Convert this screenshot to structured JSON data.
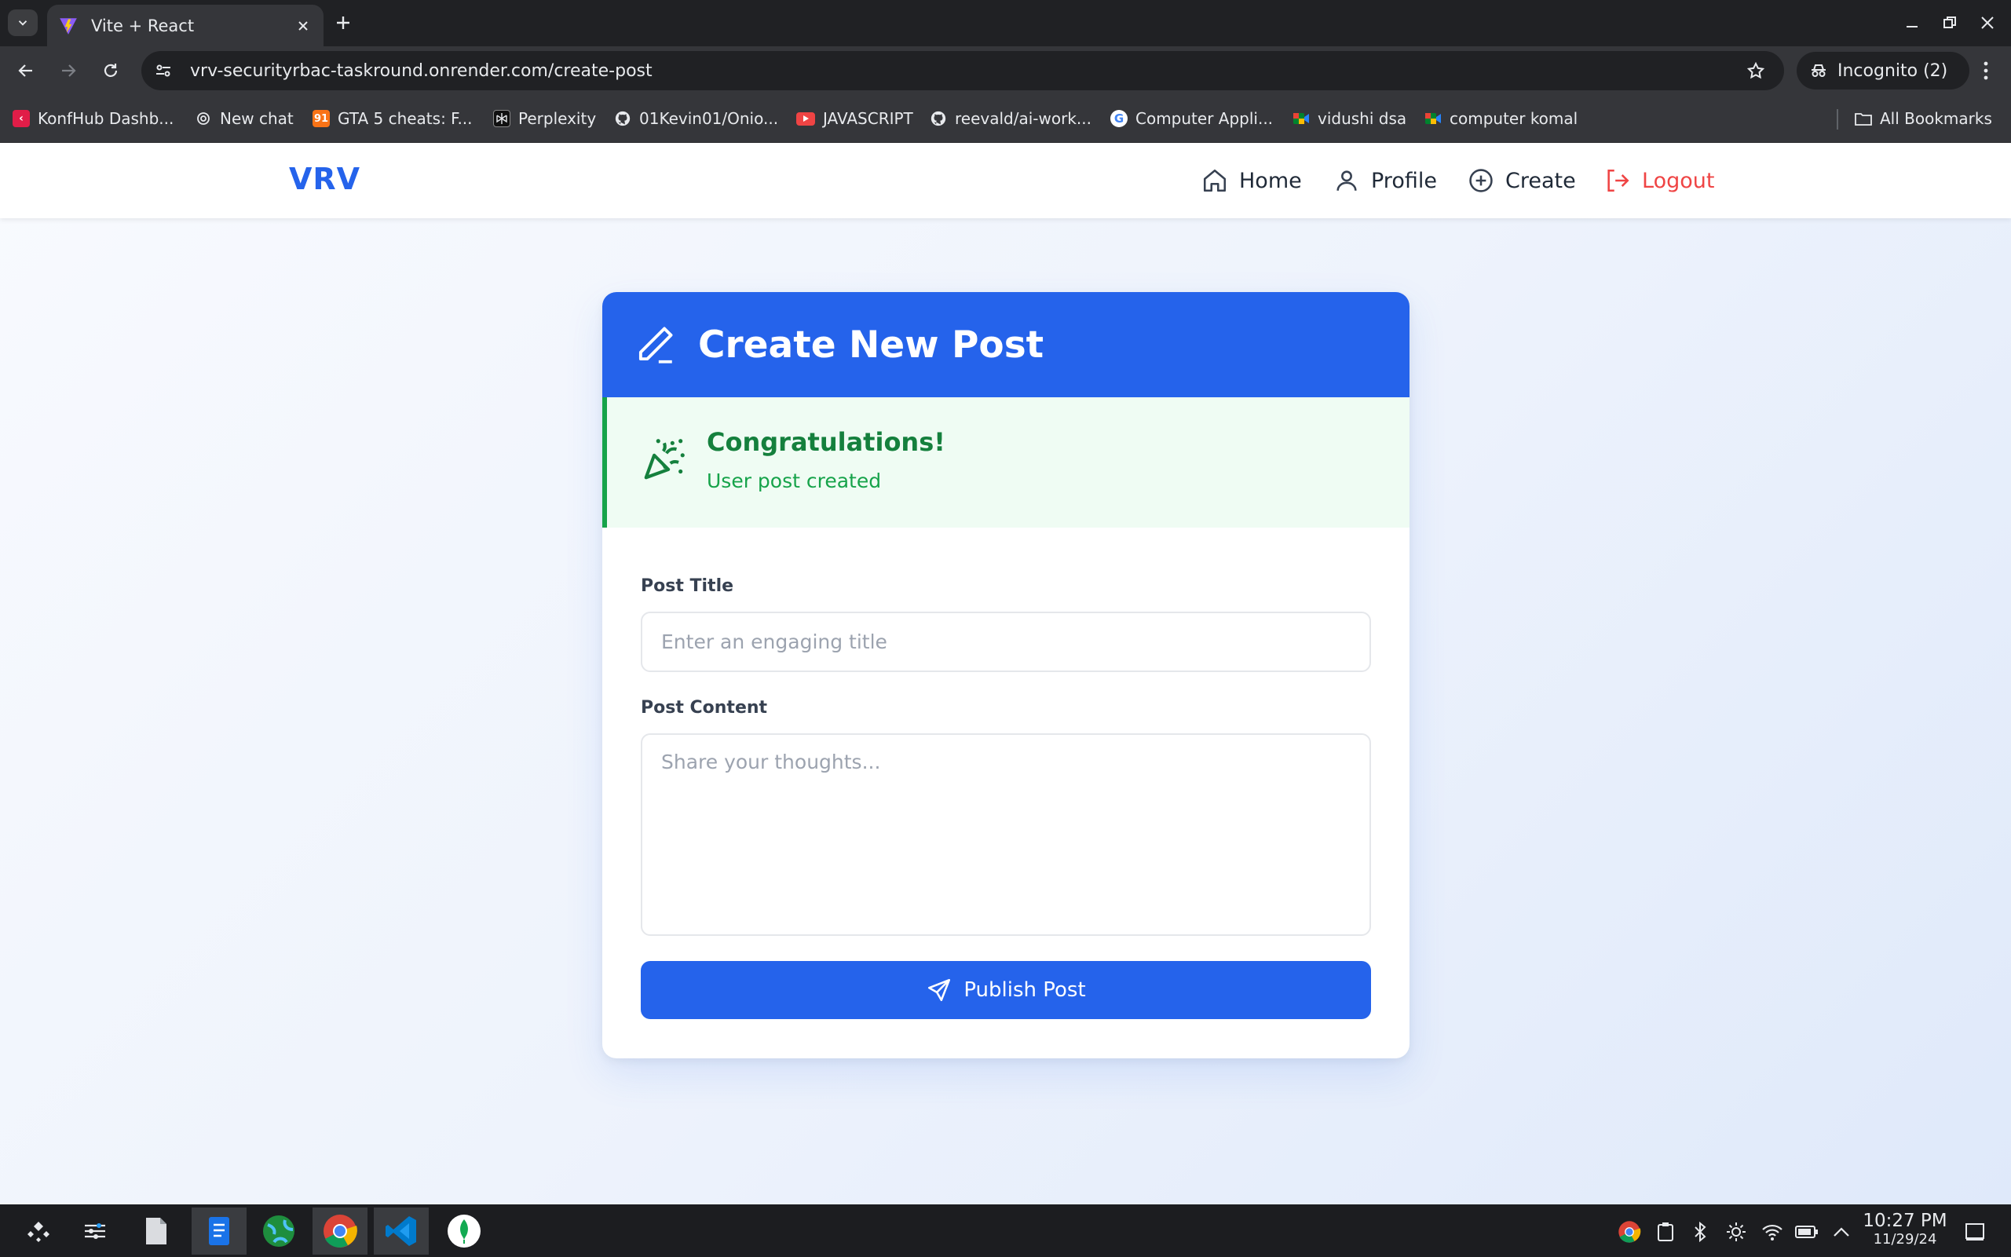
{
  "browser": {
    "tab_title": "Vite + React",
    "url": "vrv-securityrbac-taskround.onrender.com/create-post",
    "incognito_label": "Incognito (2)",
    "bookmarks": [
      {
        "label": "KonfHub Dashb...",
        "icon": "konfhub-icon",
        "color": "#e11d48"
      },
      {
        "label": "New chat",
        "icon": "openai-icon",
        "color": "#202124"
      },
      {
        "label": "GTA 5 cheats: F...",
        "icon": "gta-91-icon",
        "color": "#f97316"
      },
      {
        "label": "Perplexity",
        "icon": "perplexity-icon",
        "color": "#202124"
      },
      {
        "label": "01Kevin01/Onio...",
        "icon": "github-icon",
        "color": "#202124"
      },
      {
        "label": "JAVASCRIPT",
        "icon": "youtube-icon",
        "color": "#ef4444"
      },
      {
        "label": "reevald/ai-work...",
        "icon": "github-icon",
        "color": "#202124"
      },
      {
        "label": "Computer Appli...",
        "icon": "google-icon",
        "color": "#ffffff"
      },
      {
        "label": "vidushi dsa",
        "icon": "meet-icon",
        "color": "#00832d"
      },
      {
        "label": "computer komal",
        "icon": "meet-icon",
        "color": "#00832d"
      }
    ],
    "all_bookmarks_label": "All Bookmarks"
  },
  "app": {
    "brand": "VRV",
    "nav": {
      "home": "Home",
      "profile": "Profile",
      "create": "Create",
      "logout": "Logout"
    },
    "colors": {
      "primary": "#2563eb",
      "success": "#16a34a",
      "danger": "#ef4444"
    }
  },
  "form": {
    "header_title": "Create New Post",
    "alert": {
      "title": "Congratulations!",
      "message": "User post created"
    },
    "title_label": "Post Title",
    "title_value": "",
    "title_placeholder": "Enter an engaging title",
    "content_label": "Post Content",
    "content_value": "",
    "content_placeholder": "Share your thoughts...",
    "submit_label": "Publish Post"
  },
  "taskbar": {
    "time": "10:27 PM",
    "date": "11/29/24"
  }
}
